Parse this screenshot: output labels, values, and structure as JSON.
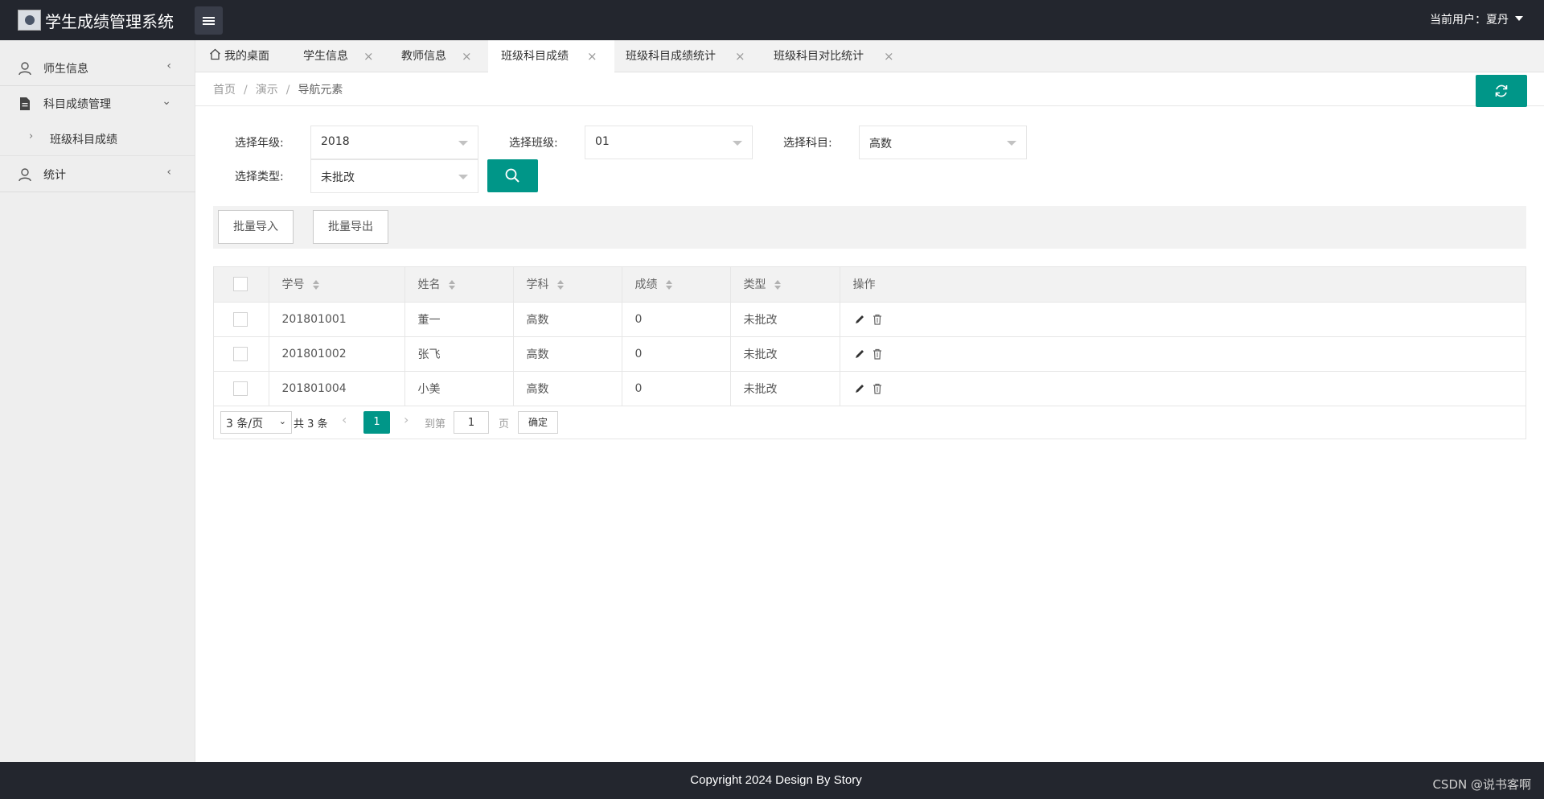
{
  "header": {
    "app_title": "学生成绩管理系统",
    "user_label": "当前用户：夏丹"
  },
  "sidebar": {
    "items": [
      {
        "label": "师生信息",
        "icon": "user-icon"
      },
      {
        "label": "科目成绩管理",
        "icon": "document-icon"
      },
      {
        "label": "班级科目成绩",
        "icon": "chevron-right-icon"
      },
      {
        "label": "统计",
        "icon": "user-icon"
      }
    ]
  },
  "tabs": [
    {
      "label": "我的桌面",
      "icon": "home-icon"
    },
    {
      "label": "学生信息"
    },
    {
      "label": "教师信息"
    },
    {
      "label": "班级科目成绩",
      "active": true
    },
    {
      "label": "班级科目成绩统计"
    },
    {
      "label": "班级科目对比统计"
    }
  ],
  "breadcrumb": [
    "首页",
    "演示",
    "导航元素"
  ],
  "filters": {
    "grade_label": "选择年级:",
    "grade_value": "2018",
    "class_label": "选择班级:",
    "class_value": "01",
    "subject_label": "选择科目:",
    "subject_value": "高数",
    "type_label": "选择类型:",
    "type_value": "未批改"
  },
  "toolbar": {
    "import_label": "批量导入",
    "export_label": "批量导出"
  },
  "table": {
    "headers": [
      "学号",
      "姓名",
      "学科",
      "成绩",
      "类型",
      "操作"
    ],
    "rows": [
      {
        "id": "201801001",
        "name": "董一",
        "subject": "高数",
        "score": "0",
        "type": "未批改"
      },
      {
        "id": "201801002",
        "name": "张飞",
        "subject": "高数",
        "score": "0",
        "type": "未批改"
      },
      {
        "id": "201801004",
        "name": "小美",
        "subject": "高数",
        "score": "0",
        "type": "未批改"
      }
    ]
  },
  "pager": {
    "per_page": "3 条/页",
    "total": "共 3 条",
    "current_page": "1",
    "goto_label": "到第",
    "goto_value": "1",
    "page_unit": "页",
    "confirm_label": "确定"
  },
  "footer": {
    "copyright": "Copyright 2024 Design By Story",
    "watermark": "CSDN @说书客啊"
  },
  "colors": {
    "accent": "#009688",
    "header_bg": "#23262e"
  }
}
